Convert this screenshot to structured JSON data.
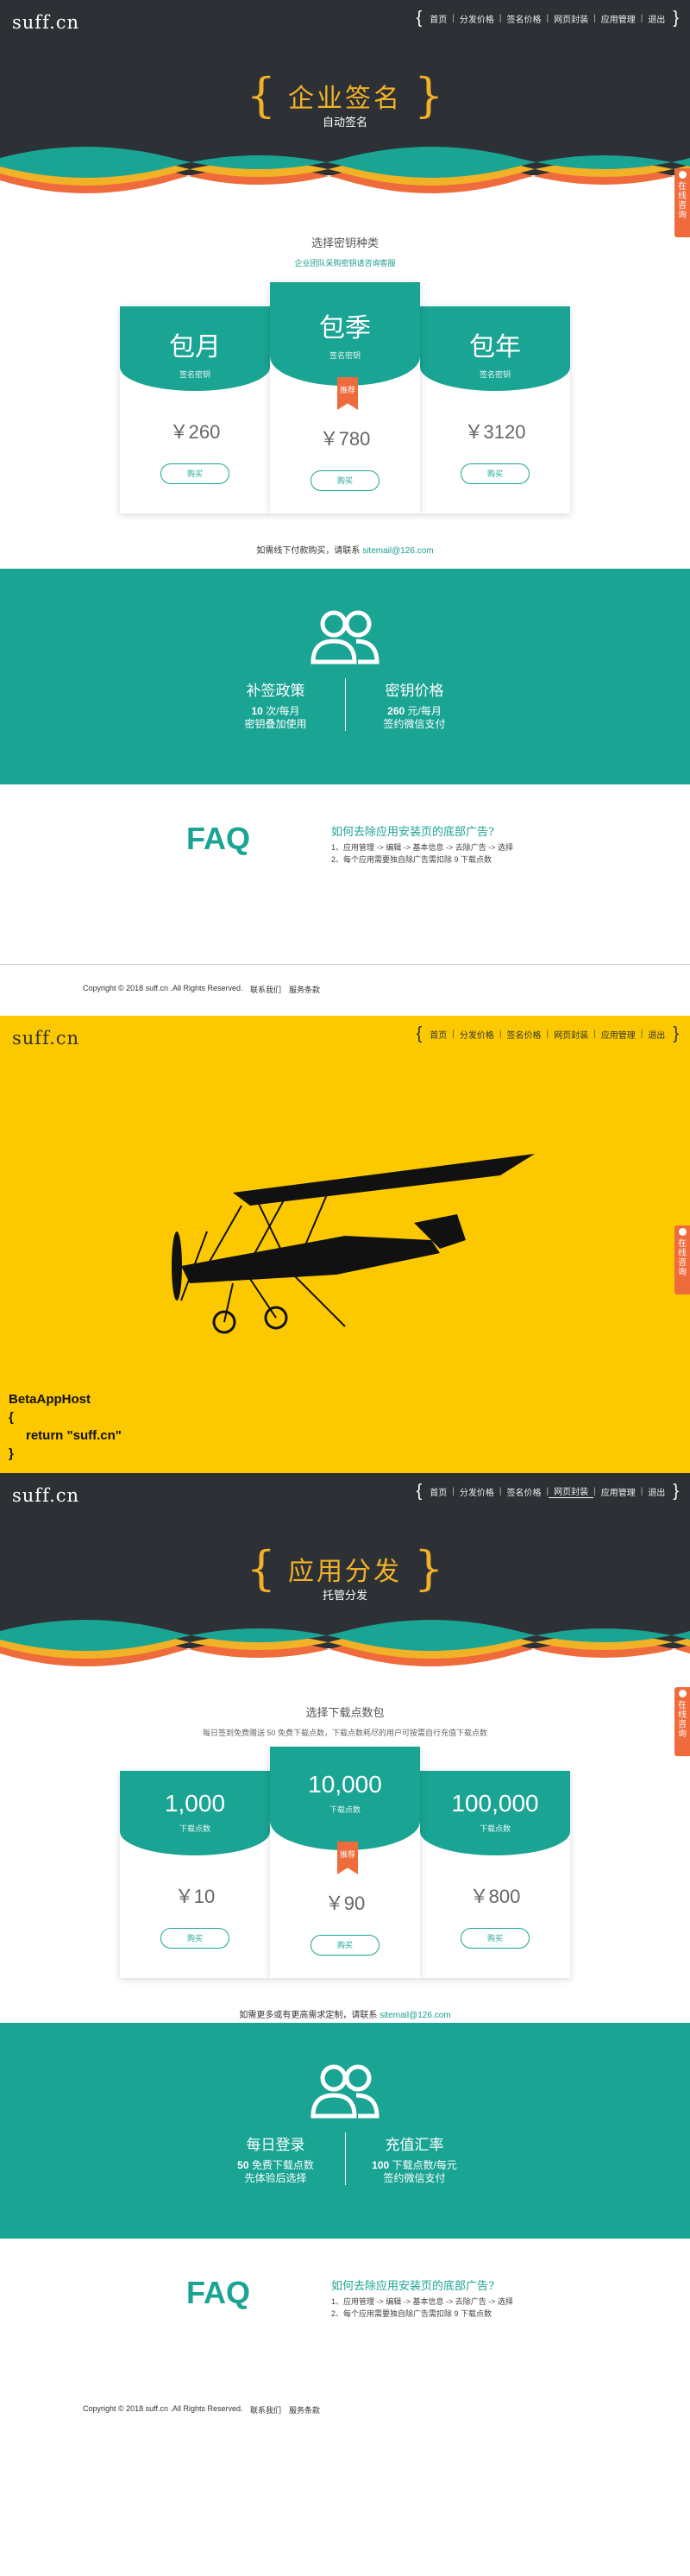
{
  "colors": {
    "teal": "#1aa493",
    "orange": "#ef6b3b",
    "gold": "#f2b227",
    "dark": "#2d3136",
    "yellow": "#fcc800"
  },
  "nav": {
    "logo": "suff.cn",
    "items": [
      "首页",
      "分发价格",
      "签名价格",
      "网页封装",
      "应用管理",
      "退出"
    ]
  },
  "side_tab": {
    "label": "在线咨询"
  },
  "section1": {
    "hero": {
      "title": "企业签名",
      "subtitle": "自动签名"
    },
    "pricing": {
      "heading": "选择密钥种类",
      "note": "企业团队采购密钥请咨询客服",
      "plans": [
        {
          "name": "包月",
          "desc": "签名密钥",
          "price": "￥260",
          "buy": "购买"
        },
        {
          "name": "包季",
          "desc": "签名密钥",
          "price": "￥780",
          "buy": "购买",
          "badge": "推荐"
        },
        {
          "name": "包年",
          "desc": "签名密钥",
          "price": "￥3120",
          "buy": "购买"
        }
      ],
      "contact": "如需线下付款购买，请联系",
      "email": "sitemail@126.com"
    },
    "teal": {
      "left_title": "补签政策",
      "left_l1_b": "10",
      "left_l1": " 次/每月",
      "left_l2": "密钥叠加使用",
      "right_title": "密钥价格",
      "right_l1_b": "260",
      "right_l1": " 元/每月",
      "right_l2": "签约微信支付"
    },
    "faq": {
      "title": "FAQ",
      "question": "如何去除应用安装页的底部广告?",
      "answer1": "1、应用管理 -> 编辑 -> 基本信息 -> 去除广告 -> 选择",
      "answer2": "2、每个应用需要独自除广告需扣除 9 下载点数"
    }
  },
  "footer": {
    "copyright": "Copyright © 2018 suff.cn .All Rights Reserved.",
    "contact": "联系我们",
    "terms": "服务条款"
  },
  "section2": {
    "code_l1": "BetaAppHost",
    "code_l2": "{",
    "code_l3": "return \"suff.cn\"",
    "code_l4": "}"
  },
  "section3": {
    "hero": {
      "title": "应用分发",
      "subtitle": "托管分发"
    },
    "pricing": {
      "heading": "选择下载点数包",
      "note": "每日签到免费赠送 50 免费下载点数，下载点数耗尽的用户可按需自行充值下载点数",
      "plans": [
        {
          "name": "1,000",
          "desc": "下载点数",
          "price": "￥10",
          "buy": "购买"
        },
        {
          "name": "10,000",
          "desc": "下载点数",
          "price": "￥90",
          "buy": "购买",
          "badge": "推荐"
        },
        {
          "name": "100,000",
          "desc": "下载点数",
          "price": "￥800",
          "buy": "购买"
        }
      ],
      "contact": "如需更多或有更高需求定制，请联系",
      "email": "sitemail@126.com"
    },
    "teal": {
      "left_title": "每日登录",
      "left_l1_b": "50",
      "left_l1": " 免费下载点数",
      "left_l2": "先体验后选择",
      "right_title": "充值汇率",
      "right_l1_b": "100",
      "right_l1": " 下载点数/每元",
      "right_l2": "签约微信支付"
    },
    "faq": {
      "title": "FAQ",
      "question": "如何去除应用安装页的底部广告?",
      "answer1": "1、应用管理 -> 编辑 -> 基本信息 -> 去除广告 -> 选择",
      "answer2": "2、每个应用需要独自除广告需扣除 9 下载点数"
    }
  }
}
